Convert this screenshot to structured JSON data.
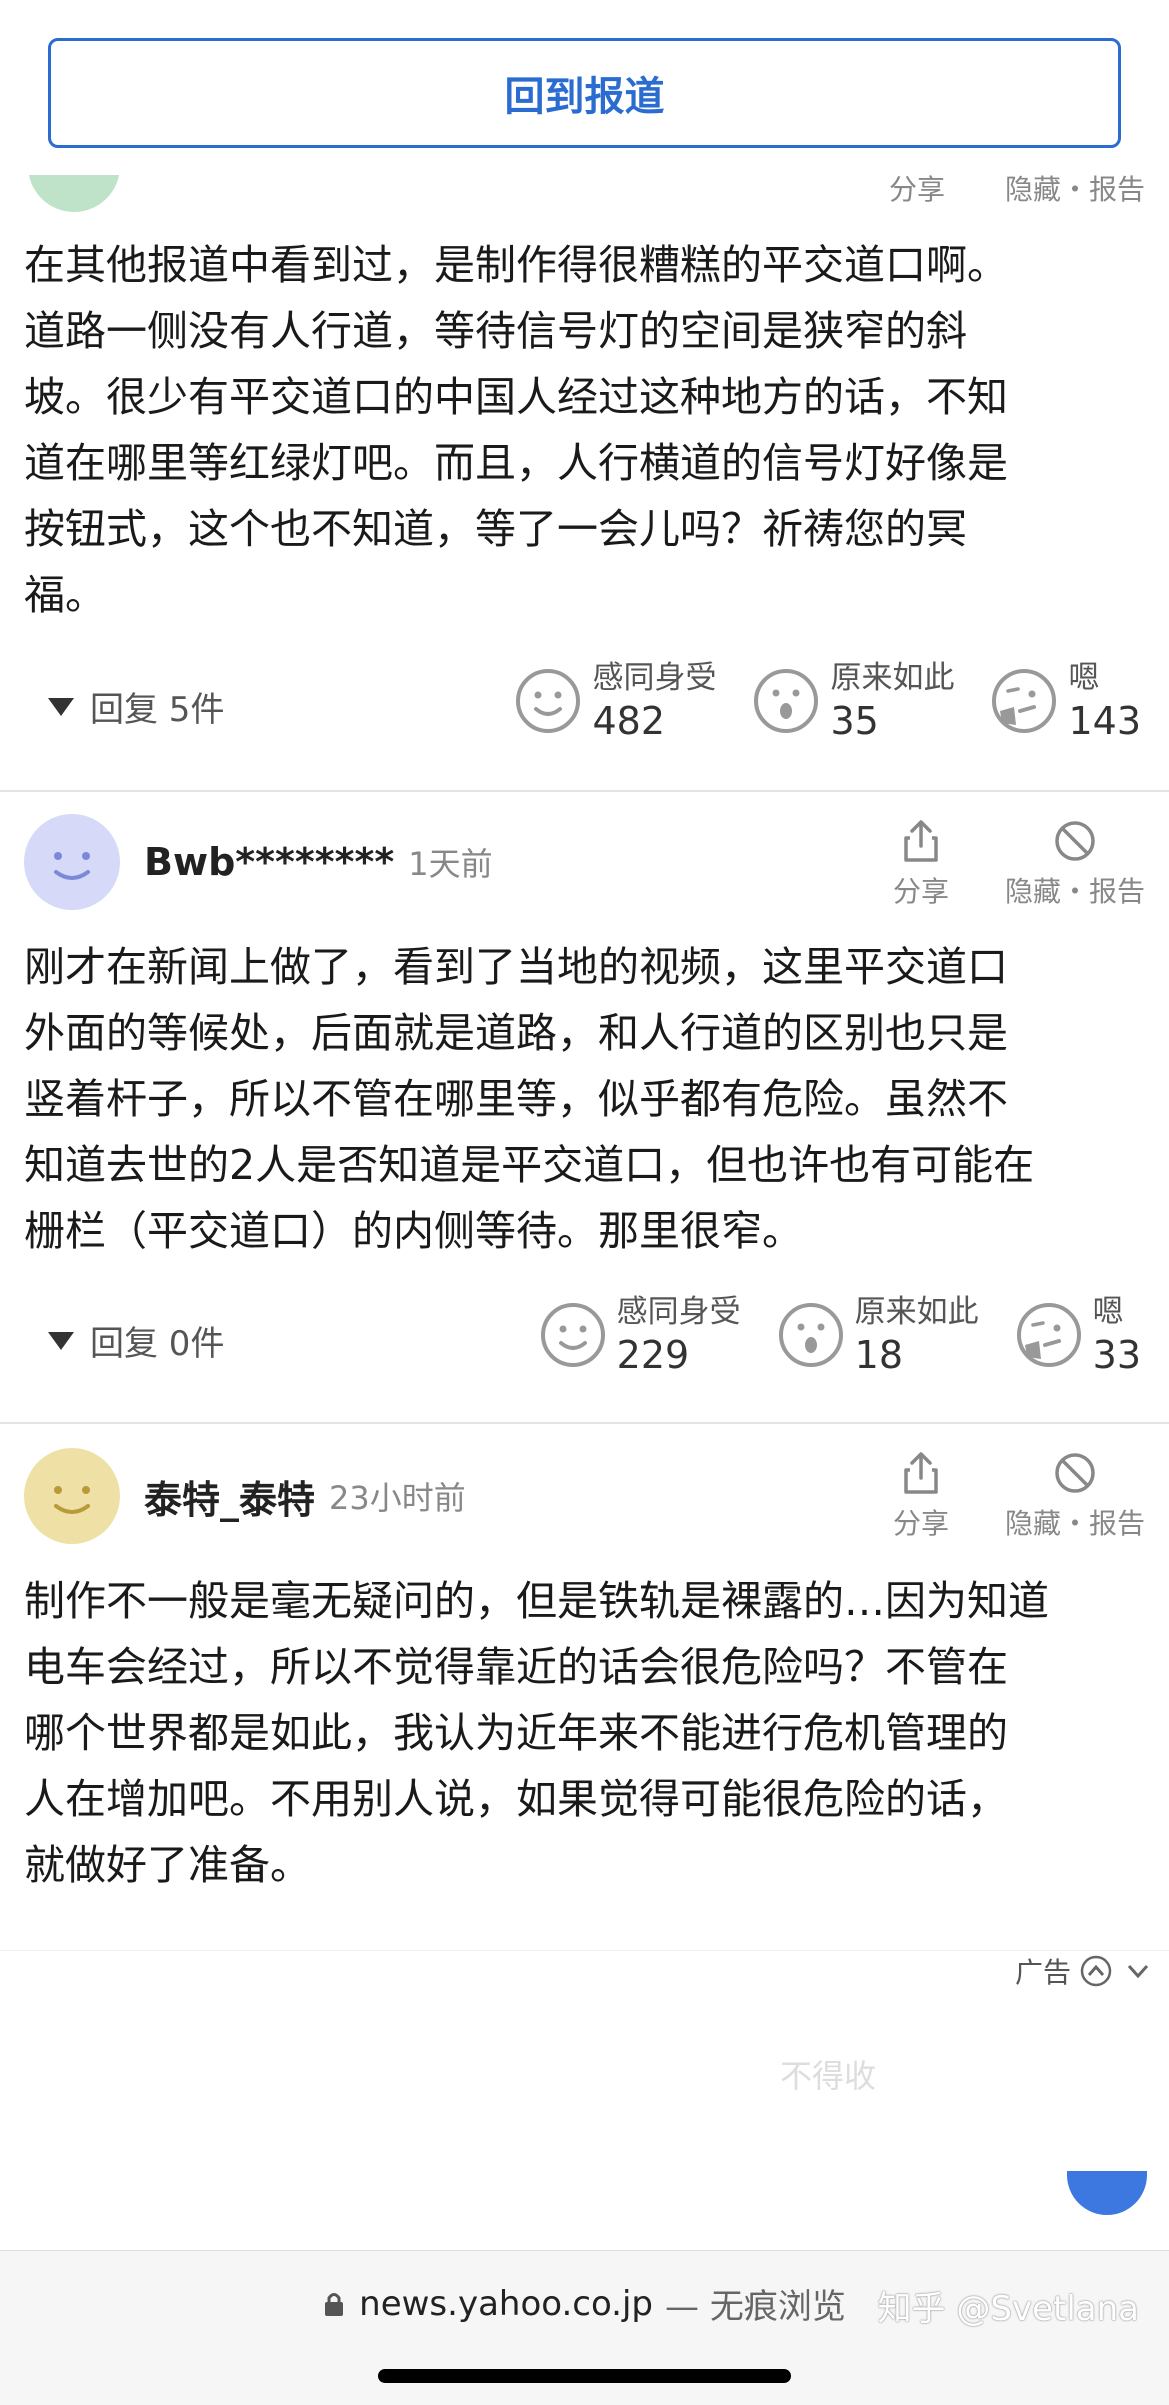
{
  "header": {
    "back_label": "回到报道"
  },
  "first_comment": {
    "actions": {
      "share": "分享",
      "hide_report": "隐藏・报告"
    },
    "body": "在其他报道中看到过，是制作得很糟糕的平交道口啊。\n道路一侧没有人行道，等待信号灯的空间是狭窄的斜\n坡。很少有平交道口的中国人经过这种地方的话，不知\n道在哪里等红绿灯吧。而且，人行横道的信号灯好像是\n按钮式，这个也不知道，等了一会儿吗？祈祷您的冥\n福。",
    "replies": "回复 5件",
    "reactions": [
      {
        "label": "感同身受",
        "count": "482"
      },
      {
        "label": "原来如此",
        "count": "35"
      },
      {
        "label": "嗯",
        "count": "143"
      }
    ]
  },
  "second_comment": {
    "username": "Bwb********",
    "time": "1天前",
    "actions": {
      "share": "分享",
      "hide_report": "隐藏・报告"
    },
    "body": "刚才在新闻上做了，看到了当地的视频，这里平交道口\n外面的等候处，后面就是道路，和人行道的区别也只是\n竖着杆子，所以不管在哪里等，似乎都有危险。虽然不\n知道去世的2人是否知道是平交道口，但也许也有可能在\n栅栏（平交道口）的内侧等待。那里很窄。",
    "replies": "回复 0件",
    "reactions": [
      {
        "label": "感同身受",
        "count": "229"
      },
      {
        "label": "原来如此",
        "count": "18"
      },
      {
        "label": "嗯",
        "count": "33"
      }
    ]
  },
  "third_comment": {
    "username": "泰特_泰特",
    "time": "23小时前",
    "actions": {
      "share": "分享",
      "hide_report": "隐藏・报告"
    },
    "body": "制作不一般是毫无疑问的，但是铁轨是裸露的…因为知道\n电车会经过，所以不觉得靠近的话会很危险吗？不管在\n哪个世界都是如此，我认为近年来不能进行危机管理的\n人在增加吧。不用别人说，如果觉得可能很危险的话，\n就做好了准备。"
  },
  "ad": {
    "label": "广告",
    "faded_text": "不得收"
  },
  "browser": {
    "url": "news.yahoo.co.jp",
    "mode": "— 无痕浏览"
  },
  "watermark": "知乎 @Svetlana",
  "colors": {
    "accent": "#2b6cd0",
    "avatar_blue": "#d6d9f7",
    "avatar_yellow": "#efe1a6",
    "avatar_green": "#bfe3c8"
  }
}
